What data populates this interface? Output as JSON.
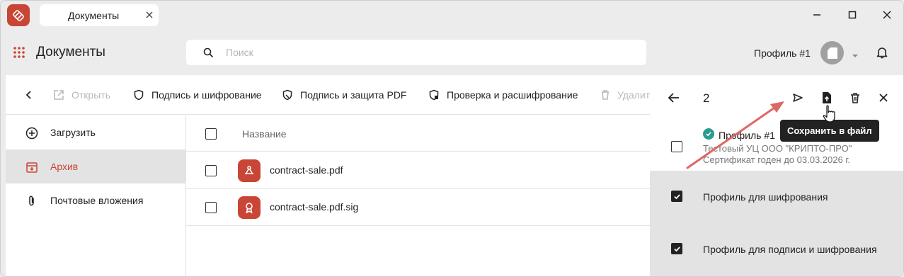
{
  "app": {
    "tab_title": "Документы",
    "page_title": "Документы"
  },
  "search": {
    "placeholder": "Поиск",
    "value": ""
  },
  "header": {
    "profile_name": "Профиль #1"
  },
  "toolbar": {
    "open": "Открыть",
    "sign_encrypt": "Подпись и шифрование",
    "sign_protect_pdf": "Подпись и защита PDF",
    "verify_decrypt": "Проверка и расшифрование",
    "delete": "Удалить"
  },
  "sidebar": {
    "items": [
      {
        "label": "Загрузить",
        "icon": "add-circle-icon"
      },
      {
        "label": "Архив",
        "icon": "archive-icon",
        "active": true
      },
      {
        "label": "Почтовые вложения",
        "icon": "paperclip-icon"
      }
    ]
  },
  "list": {
    "column_name": "Название",
    "rows": [
      {
        "name": "contract-sale.pdf",
        "icon": "pdf-icon"
      },
      {
        "name": "contract-sale.pdf.sig",
        "icon": "signature-seal-icon"
      }
    ]
  },
  "panel": {
    "count": "2",
    "tooltip": "Сохранить в файл",
    "profiles": [
      {
        "title": "Профиль #1",
        "issuer": "Тестовый УЦ ООО \"КРИПТО-ПРО\"",
        "validity": "Сертификат годен до 03.03.2026 г.",
        "checked": false,
        "verified": true
      },
      {
        "title": "Профиль для шифрования",
        "checked": true
      },
      {
        "title": "Профиль для подписи и шифрования",
        "checked": true
      }
    ]
  },
  "colors": {
    "accent": "#c94535",
    "verified": "#2a9d8f",
    "annotation_arrow": "#e06666"
  }
}
